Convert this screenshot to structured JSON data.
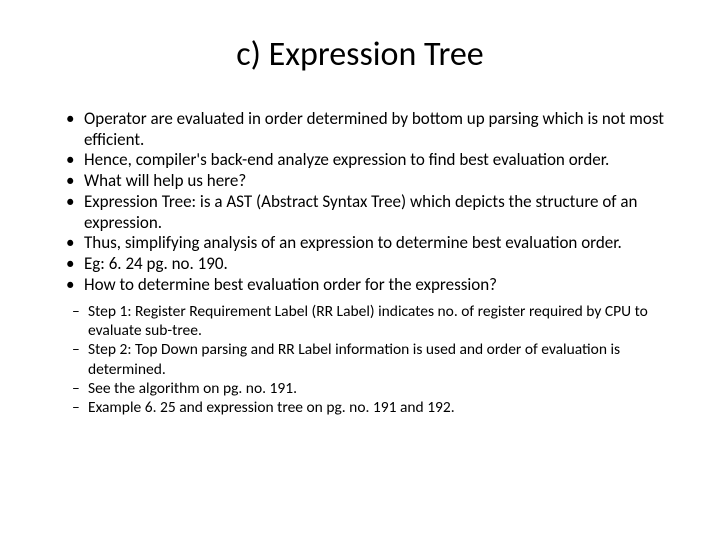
{
  "title": "c) Expression Tree",
  "bullets": [
    "Operator are evaluated in order determined by bottom up parsing which is not most efficient.",
    "Hence, compiler's back-end analyze expression to find best evaluation order.",
    "What will help us here?",
    "Expression Tree: is a AST (Abstract Syntax Tree) which depicts the structure of an expression.",
    "Thus, simplifying analysis of an expression to determine best evaluation order.",
    "Eg: 6. 24 pg. no. 190.",
    "How to determine best evaluation order for the expression?"
  ],
  "sub_bullets": [
    "Step 1: Register Requirement Label (RR Label) indicates no. of register required by CPU to evaluate sub-tree.",
    "Step 2: Top Down parsing and RR Label information is used and order of evaluation is determined.",
    "See the algorithm on pg. no. 191.",
    "Example 6. 25 and expression tree on pg. no. 191 and 192."
  ]
}
